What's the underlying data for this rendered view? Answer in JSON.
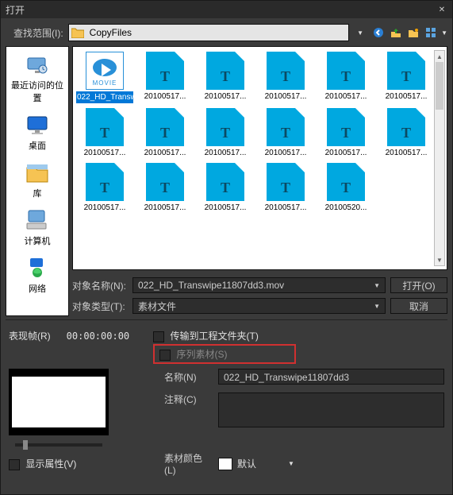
{
  "titlebar": {
    "title": "打开"
  },
  "lookin": {
    "label": "查找范围(I):",
    "folder": "CopyFiles"
  },
  "toolbar_icons": [
    "back-icon",
    "up-icon",
    "new-folder-icon",
    "view-icon"
  ],
  "sidebar": {
    "items": [
      {
        "id": "recent",
        "label": "最近访问的位置"
      },
      {
        "id": "desktop",
        "label": "桌面"
      },
      {
        "id": "library",
        "label": "库"
      },
      {
        "id": "computer",
        "label": "计算机"
      },
      {
        "id": "network",
        "label": "网络"
      }
    ]
  },
  "files": [
    {
      "name": "022_HD_Transwipe11807dd3.mov",
      "selected": true,
      "kind": "movie"
    },
    {
      "name": "20100517...",
      "selected": false
    },
    {
      "name": "20100517...",
      "selected": false
    },
    {
      "name": "20100517...",
      "selected": false
    },
    {
      "name": "20100517...",
      "selected": false
    },
    {
      "name": "20100517...",
      "selected": false
    },
    {
      "name": "20100517...",
      "selected": false
    },
    {
      "name": "20100517...",
      "selected": false
    },
    {
      "name": "20100517...",
      "selected": false
    },
    {
      "name": "20100517...",
      "selected": false
    },
    {
      "name": "20100517...",
      "selected": false
    },
    {
      "name": "20100517...",
      "selected": false
    },
    {
      "name": "20100517...",
      "selected": false
    },
    {
      "name": "20100517...",
      "selected": false
    },
    {
      "name": "20100517...",
      "selected": false
    },
    {
      "name": "20100517...",
      "selected": false
    },
    {
      "name": "20100520...",
      "selected": false
    }
  ],
  "fields": {
    "objname_label": "对象名称(N):",
    "objname_value": "022_HD_Transwipe11807dd3.mov",
    "objtype_label": "对象类型(T):",
    "objtype_value": "素材文件"
  },
  "buttons": {
    "open": "打开(O)",
    "cancel": "取消"
  },
  "lower": {
    "reprframe_label": "表现帧(R)",
    "timecode": "00:00:00:00",
    "transfer_label": "传输到工程文件夹(T)",
    "sequence_label": "序列素材(S)",
    "name_label": "名称(N)",
    "name_value": "022_HD_Transwipe11807dd3",
    "comment_label": "注释(C)",
    "comment_value": "",
    "showattr_label": "显示属性(V)",
    "matcolor_label": "素材颜色(L)",
    "color_name": "默认"
  }
}
